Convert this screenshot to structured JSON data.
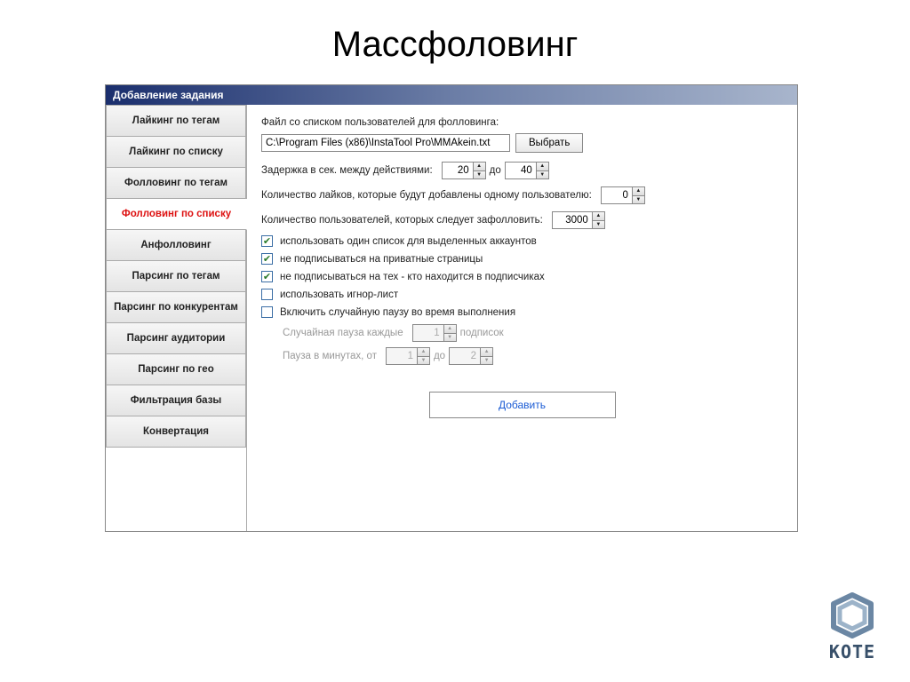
{
  "slide_title": "Массфоловинг",
  "window_title": "Добавление задания",
  "sidebar": {
    "items": [
      {
        "label": "Лайкинг по тегам"
      },
      {
        "label": "Лайкинг по списку"
      },
      {
        "label": "Фолловинг по тегам"
      },
      {
        "label": "Фолловинг по списку"
      },
      {
        "label": "Анфолловинг"
      },
      {
        "label": "Парсинг по тегам"
      },
      {
        "label": "Парсинг по конкурентам"
      },
      {
        "label": "Парсинг аудитории"
      },
      {
        "label": "Парсинг по гео"
      },
      {
        "label": "Фильтрация базы"
      },
      {
        "label": "Конвертация"
      }
    ],
    "active_index": 3
  },
  "form": {
    "file_label": "Файл со списком пользователей для фолловинга:",
    "file_value": "C:\\Program Files (x86)\\InstaTool Pro\\MMAkein.txt",
    "browse_label": "Выбрать",
    "delay_label": "Задержка в сек. между действиями:",
    "delay_from": "20",
    "delay_to_word": "до",
    "delay_to": "40",
    "likes_label": "Количество лайков, которые будут добавлены одному пользователю:",
    "likes_value": "0",
    "users_label": "Количество пользователей, которых следует зафолловить:",
    "users_value": "3000",
    "checkboxes": [
      {
        "checked": true,
        "label": "использовать один список для выделенных аккаунтов"
      },
      {
        "checked": true,
        "label": "не подписываться на приватные страницы"
      },
      {
        "checked": true,
        "label": "не подписываться на тех - кто находится в подписчиках"
      },
      {
        "checked": false,
        "label": "использовать игнор-лист"
      },
      {
        "checked": false,
        "label": "Включить случайную паузу во время выполнения"
      }
    ],
    "random_pause": {
      "every_label": "Случайная пауза каждые",
      "every_value": "1",
      "every_suffix": "подписок",
      "pause_label": "Пауза в минутах, от",
      "pause_from": "1",
      "pause_to_word": "до",
      "pause_to": "2"
    },
    "submit_label": "Добавить"
  },
  "brand": "KOTE"
}
